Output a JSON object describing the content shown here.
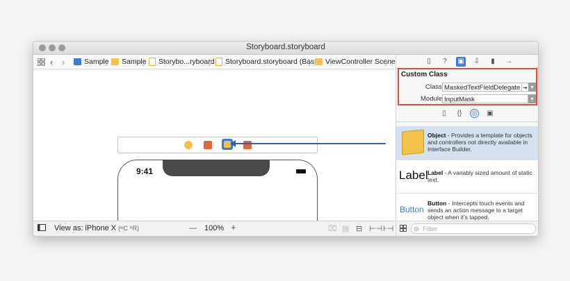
{
  "window": {
    "title": "Storyboard.storyboard"
  },
  "navbar": {
    "crumbs": [
      {
        "label": "Sample",
        "icon": "project-icon",
        "color": "#3d7bd8"
      },
      {
        "label": "Sample",
        "icon": "folder-icon",
        "color": "#f4c24a"
      },
      {
        "label": "Storybo...ryboard",
        "icon": "storyboard-file-icon",
        "color": "#f2c94c"
      },
      {
        "label": "Storyboard.storyboard (Base)",
        "icon": "storyboard-file-icon",
        "color": "#f2c94c"
      },
      {
        "label": "ViewController Scene",
        "icon": "scene-icon",
        "color": "#f4c24a"
      }
    ]
  },
  "canvas": {
    "time": "9:41"
  },
  "bottombar": {
    "view_as": "View as: iPhone X",
    "shortcut": "(",
    "shortcut_mid": "C",
    "shortcut_r": "R)",
    "zoom_minus": "—",
    "zoom": "100%",
    "zoom_plus": "+"
  },
  "inspector": {
    "custom_class": {
      "title": "Custom Class",
      "class_label": "Class",
      "class_value": "MaskedTextFieldDelegate",
      "module_label": "Module",
      "module_value": "InputMask"
    },
    "library": [
      {
        "name": "Object",
        "desc": " - Provides a template for objects and controllers not directly available in Interface Builder.",
        "thumb": "Object"
      },
      {
        "name": "Label",
        "desc": " - A variably sized amount of static text.",
        "thumb": "Label"
      },
      {
        "name": "Button",
        "desc": " - Intercepts touch events and sends an action message to a target object when it's tapped.",
        "thumb": "Button"
      }
    ],
    "filter_placeholder": "Filter"
  },
  "colors": {
    "accent": "#3b7be0",
    "highlight_border": "#e04a3f",
    "arrow": "#3b5ea8"
  }
}
